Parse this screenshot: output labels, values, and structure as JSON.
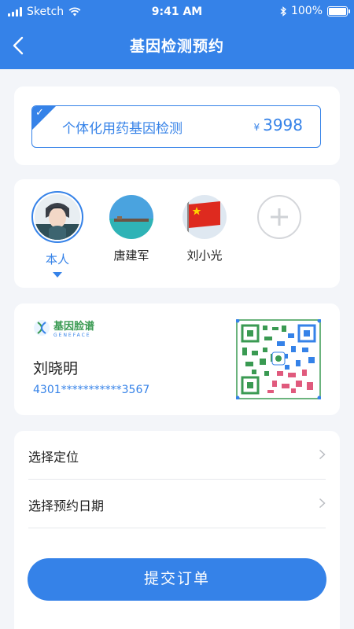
{
  "status_bar": {
    "carrier": "Sketch",
    "time": "9:41 AM",
    "battery": "100%"
  },
  "header": {
    "title": "基因检测预约",
    "back_icon": "chevron-left-icon"
  },
  "product": {
    "name": "个体化用药基因检测",
    "currency": "¥",
    "price": "3998",
    "selected": true
  },
  "people": [
    {
      "label": "本人",
      "active": true
    },
    {
      "label": "唐建军",
      "active": false
    },
    {
      "label": "刘小光",
      "active": false
    }
  ],
  "add_person_icon": "plus-icon",
  "id_card": {
    "logo_cn": "基因脸谱",
    "logo_en": "GENEFACE",
    "name": "刘晓明",
    "id_number": "4301***********3567"
  },
  "options": [
    {
      "label": "选择定位"
    },
    {
      "label": "选择预约日期"
    }
  ],
  "submit_label": "提交订单",
  "colors": {
    "accent": "#3582e8",
    "background": "#f3f5f9"
  }
}
